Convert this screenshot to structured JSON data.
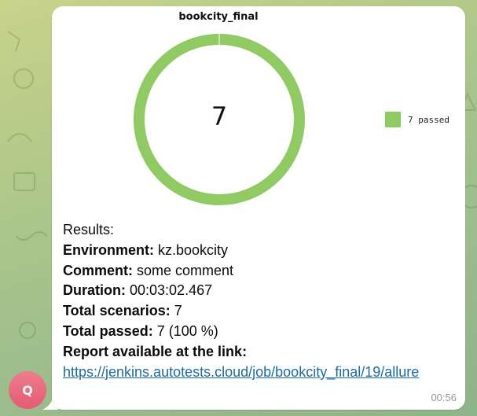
{
  "chat": {
    "avatar_initial": "Q",
    "timestamp": "00:56"
  },
  "chart_data": {
    "type": "pie",
    "title": "bookcity_final",
    "center_label": "7",
    "slices": [
      {
        "label": "7 passed",
        "value": 7,
        "color": "#8fcb62"
      }
    ],
    "legend_position": "right"
  },
  "report": {
    "heading": "Results:",
    "lines": [
      {
        "label": "Environment:",
        "value": " kz.bookcity"
      },
      {
        "label": "Comment:",
        "value": " some comment"
      },
      {
        "label": "Duration:",
        "value": " 00:03:02.467"
      },
      {
        "label": "Total scenarios:",
        "value": " 7"
      },
      {
        "label": "Total passed:",
        "value": " 7 (100 %)"
      },
      {
        "label": "Report available at the link:",
        "value": ""
      }
    ],
    "link": "https://jenkins.autotests.cloud/job/bookcity_final/19/allure"
  },
  "colors": {
    "passed": "#8fcb62",
    "link": "#1c6aa8",
    "avatar": "#e8637a"
  }
}
